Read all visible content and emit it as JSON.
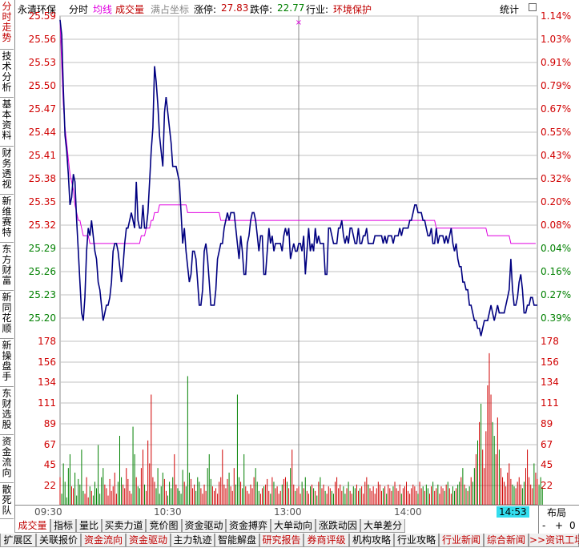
{
  "sidebar": {
    "tabs": [
      {
        "label": "分时走势",
        "active": true
      },
      {
        "label": "技术分析",
        "active": false
      },
      {
        "label": "基本资料",
        "active": false
      },
      {
        "label": "财务透视",
        "active": false
      },
      {
        "label": "新维赛特",
        "active": false
      },
      {
        "label": "东方财富",
        "active": false
      },
      {
        "label": "新同花顺",
        "active": false
      },
      {
        "label": "新操盘手",
        "active": false
      },
      {
        "label": "东财选股",
        "active": false
      },
      {
        "label": "资金流向",
        "active": false
      },
      {
        "label": "散死队",
        "active": false
      }
    ]
  },
  "header": {
    "stock_name": "永清环保",
    "mode": "分时",
    "avg_label": "均线",
    "vol_label": "成交量",
    "scale_label": "满占坐标",
    "limit_up_label": "涨停:",
    "limit_up": "27.83",
    "limit_down_label": "跌停:",
    "limit_down": "22.77",
    "industry_label": "行业:",
    "industry": "环境保护",
    "stats_button": "统计"
  },
  "colors": {
    "price_line": "#000080",
    "avg_line": "#e000e0",
    "up": "#d00000",
    "down": "#008000",
    "grid": "#c0c0c0",
    "accent": "#c00000"
  },
  "chart_data": {
    "type": "line",
    "price_axis": [
      "25.59",
      "25.56",
      "25.53",
      "25.50",
      "25.47",
      "25.44",
      "25.41",
      "25.38",
      "25.35",
      "25.32",
      "25.29",
      "25.26",
      "25.23",
      "25.20"
    ],
    "pct_axis": [
      "1.14%",
      "1.03%",
      "0.91%",
      "0.79%",
      "0.67%",
      "0.55%",
      "0.43%",
      "0.32%",
      "0.20%",
      "0.08%",
      "0.04%",
      "0.16%",
      "0.27%",
      "0.39%"
    ],
    "volume_axis": [
      "178",
      "156",
      "134",
      "111",
      "89",
      "67",
      "45",
      "22"
    ],
    "price_ylim": [
      25.195,
      25.595
    ],
    "time_labels": [
      "09:30",
      "10:30",
      "13:00",
      "14:00"
    ],
    "current_time": "14:53",
    "price": [
      25.59,
      25.57,
      25.5,
      25.44,
      25.42,
      25.39,
      25.35,
      25.36,
      25.39,
      25.38,
      25.33,
      25.29,
      25.25,
      25.21,
      25.2,
      25.23,
      25.29,
      25.32,
      25.31,
      25.33,
      25.31,
      25.29,
      25.28,
      25.25,
      25.24,
      25.22,
      25.2,
      25.21,
      25.22,
      25.22,
      25.23,
      25.25,
      25.29,
      25.3,
      25.3,
      25.29,
      25.27,
      25.25,
      25.27,
      25.3,
      25.32,
      25.32,
      25.33,
      25.34,
      25.33,
      25.32,
      25.38,
      25.33,
      25.32,
      25.32,
      25.35,
      25.32,
      25.32,
      25.34,
      25.38,
      25.42,
      25.45,
      25.53,
      25.51,
      25.48,
      25.44,
      25.42,
      25.4,
      25.47,
      25.49,
      25.47,
      25.45,
      25.43,
      25.4,
      25.4,
      25.4,
      25.39,
      25.38,
      25.34,
      25.3,
      25.32,
      25.29,
      25.27,
      25.25,
      25.26,
      25.29,
      25.29,
      25.28,
      25.25,
      25.22,
      25.22,
      25.24,
      25.29,
      25.3,
      25.28,
      25.25,
      25.22,
      25.22,
      25.22,
      25.24,
      25.28,
      25.29,
      25.3,
      25.3,
      25.32,
      25.33,
      25.34,
      25.33,
      25.34,
      25.34,
      25.34,
      25.32,
      25.3,
      25.28,
      25.31,
      25.29,
      25.26,
      25.26,
      25.3,
      25.31,
      25.33,
      25.34,
      25.34,
      25.33,
      25.31,
      25.29,
      25.31,
      25.31,
      25.26,
      25.26,
      25.29,
      25.32,
      25.3,
      25.31,
      25.29,
      25.3,
      25.3,
      25.3,
      25.3,
      25.29,
      25.31,
      25.32,
      25.31,
      25.32,
      25.28,
      25.29,
      25.3,
      25.29,
      25.29,
      25.3,
      25.3,
      25.29,
      25.31,
      25.26,
      25.29,
      25.32,
      25.29,
      25.3,
      25.29,
      25.32,
      25.3,
      25.31,
      25.3,
      25.3,
      25.3,
      25.26,
      25.26,
      25.32,
      25.32,
      25.31,
      25.3,
      25.3,
      25.3,
      25.32,
      25.32,
      25.33,
      25.31,
      25.3,
      25.31,
      25.3,
      25.32,
      25.32,
      25.31,
      25.3,
      25.3,
      25.32,
      25.3,
      25.3,
      25.31,
      25.31,
      25.32,
      25.3,
      25.3,
      25.3,
      25.3,
      25.31,
      25.31,
      25.31,
      25.31,
      25.31,
      25.3,
      25.31,
      25.3,
      25.31,
      25.31,
      25.31,
      25.3,
      25.31,
      25.31,
      25.31,
      25.32,
      25.31,
      25.32,
      25.32,
      25.32,
      25.32,
      25.33,
      25.33,
      25.34,
      25.35,
      25.35,
      25.34,
      25.34,
      25.34,
      25.33,
      25.33,
      25.32,
      25.31,
      25.31,
      25.32,
      25.3,
      25.3,
      25.32,
      25.3,
      25.31,
      25.31,
      25.31,
      25.3,
      25.31,
      25.3,
      25.31,
      25.32,
      25.3,
      25.29,
      25.3,
      25.28,
      25.27,
      25.27,
      25.25,
      25.25,
      25.24,
      25.24,
      25.22,
      25.22,
      25.21,
      25.2,
      25.2,
      25.19,
      25.19,
      25.18,
      25.19,
      25.2,
      25.2,
      25.2,
      25.21,
      25.22,
      25.21,
      25.2,
      25.21,
      25.22,
      25.21,
      25.21,
      25.21,
      25.21,
      25.22,
      25.23,
      25.24,
      25.28,
      25.24,
      25.22,
      25.22,
      25.23,
      25.25,
      25.26,
      25.24,
      25.21,
      25.21,
      25.22,
      25.22,
      25.23,
      25.23,
      25.22,
      25.22,
      25.22
    ],
    "avg": [
      25.59,
      25.53,
      25.48,
      25.45,
      25.43,
      25.41,
      25.39,
      25.38,
      25.37,
      25.35,
      25.34,
      25.33,
      25.33,
      25.32,
      25.31,
      25.31,
      25.31,
      25.31,
      25.3,
      25.3,
      25.3,
      25.3,
      25.3,
      25.3,
      25.3,
      25.3,
      25.3,
      25.3,
      25.3,
      25.3,
      25.3,
      25.3,
      25.3,
      25.3,
      25.3,
      25.3,
      25.3,
      25.3,
      25.3,
      25.3,
      25.3,
      25.3,
      25.3,
      25.3,
      25.3,
      25.3,
      25.3,
      25.3,
      25.3,
      25.31,
      25.31,
      25.31,
      25.32,
      25.32,
      25.32,
      25.33,
      25.33,
      25.34,
      25.34,
      25.34,
      25.35,
      25.35,
      25.35,
      25.35,
      25.35,
      25.35,
      25.35,
      25.35,
      25.35,
      25.35,
      25.35,
      25.35,
      25.35,
      25.35,
      25.35,
      25.35,
      25.35,
      25.34,
      25.34,
      25.34,
      25.34,
      25.34,
      25.34,
      25.34,
      25.34,
      25.34,
      25.34,
      25.34,
      25.34,
      25.34,
      25.34,
      25.34,
      25.34,
      25.34,
      25.34,
      25.34,
      25.34,
      25.33,
      25.33,
      25.33,
      25.33,
      25.33,
      25.33,
      25.33,
      25.33,
      25.33,
      25.33,
      25.33,
      25.33,
      25.33,
      25.33,
      25.33,
      25.33,
      25.33,
      25.33,
      25.33,
      25.33,
      25.33,
      25.33,
      25.33,
      25.33,
      25.33,
      25.33,
      25.33,
      25.33,
      25.33,
      25.33,
      25.33,
      25.33,
      25.33,
      25.33,
      25.33,
      25.33,
      25.33,
      25.33,
      25.33,
      25.33,
      25.33,
      25.33,
      25.33,
      25.33,
      25.33,
      25.33,
      25.33,
      25.33,
      25.33,
      25.33,
      25.33,
      25.33,
      25.33,
      25.33,
      25.33,
      25.33,
      25.33,
      25.33,
      25.33,
      25.33,
      25.33,
      25.33,
      25.33,
      25.33,
      25.33,
      25.33,
      25.33,
      25.33,
      25.33,
      25.33,
      25.33,
      25.33,
      25.33,
      25.33,
      25.33,
      25.33,
      25.33,
      25.33,
      25.33,
      25.33,
      25.33,
      25.33,
      25.33,
      25.33,
      25.33,
      25.33,
      25.33,
      25.33,
      25.33,
      25.33,
      25.33,
      25.33,
      25.33,
      25.33,
      25.33,
      25.33,
      25.33,
      25.33,
      25.33,
      25.33,
      25.33,
      25.33,
      25.33,
      25.33,
      25.33,
      25.33,
      25.33,
      25.33,
      25.33,
      25.33,
      25.33,
      25.33,
      25.33,
      25.33,
      25.33,
      25.33,
      25.33,
      25.33,
      25.33,
      25.33,
      25.33,
      25.33,
      25.33,
      25.33,
      25.33,
      25.33,
      25.33,
      25.33,
      25.33,
      25.33,
      25.32,
      25.32,
      25.32,
      25.32,
      25.32,
      25.32,
      25.32,
      25.32,
      25.32,
      25.32,
      25.32,
      25.32,
      25.32,
      25.32,
      25.32,
      25.32,
      25.32,
      25.32,
      25.32,
      25.32,
      25.32,
      25.32,
      25.32,
      25.32,
      25.32,
      25.32,
      25.32,
      25.32,
      25.32,
      25.32,
      25.32,
      25.31,
      25.31,
      25.31,
      25.31,
      25.31,
      25.31,
      25.31,
      25.31,
      25.31,
      25.31,
      25.31,
      25.31,
      25.31,
      25.31,
      25.3,
      25.3,
      25.3,
      25.3,
      25.3,
      25.3,
      25.3,
      25.3,
      25.3,
      25.3,
      25.3,
      25.3,
      25.3,
      25.3,
      25.3,
      25.3
    ],
    "volume_ylim": [
      0,
      178
    ],
    "volume": [
      30,
      12,
      45,
      25,
      8,
      40,
      55,
      20,
      18,
      35,
      10,
      28,
      22,
      60,
      15,
      12,
      30,
      8,
      20,
      15,
      10,
      25,
      18,
      65,
      12,
      30,
      40,
      22,
      18,
      10,
      28,
      15,
      20,
      35,
      12,
      25,
      75,
      30,
      22,
      18,
      40,
      28,
      15,
      12,
      85,
      55,
      30,
      20,
      18,
      40,
      60,
      22,
      15,
      70,
      45,
      120,
      30,
      25,
      18,
      40,
      12,
      20,
      35,
      28,
      15,
      10,
      25,
      18,
      30,
      55,
      22,
      18,
      15,
      12,
      38,
      25,
      20,
      140,
      35,
      28,
      18,
      22,
      15,
      30,
      25,
      18,
      12,
      22,
      15,
      40,
      55,
      28,
      20,
      15,
      18,
      12,
      25,
      30,
      60,
      22,
      18,
      28,
      35,
      20,
      15,
      40,
      22,
      120,
      30,
      25,
      18,
      55,
      20,
      15,
      12,
      22,
      18,
      30,
      40,
      25,
      15,
      12,
      18,
      20,
      22,
      28,
      15,
      12,
      30,
      25,
      18,
      20,
      12,
      15,
      22,
      28,
      30,
      25,
      18,
      40,
      60,
      22,
      15,
      18,
      20,
      12,
      25,
      18,
      30,
      15,
      12,
      20,
      22,
      18,
      15,
      10,
      25,
      30,
      18,
      22,
      15,
      12,
      20,
      18,
      15,
      12,
      25,
      30,
      18,
      22,
      15,
      20,
      12,
      18,
      25,
      15,
      12,
      20,
      18,
      22,
      15,
      18,
      20,
      12,
      25,
      30,
      22,
      18,
      15,
      20,
      12,
      18,
      25,
      22,
      15,
      18,
      20,
      12,
      22,
      18,
      15,
      20,
      25,
      18,
      15,
      22,
      12,
      18,
      20,
      25,
      15,
      12,
      18,
      22,
      20,
      15,
      12,
      25,
      18,
      20,
      15,
      22,
      18,
      12,
      20,
      25,
      15,
      18,
      22,
      12,
      20,
      18,
      15,
      22,
      25,
      18,
      12,
      20,
      15,
      18,
      22,
      25,
      30,
      40,
      22,
      18,
      15,
      20,
      30,
      25,
      40,
      55,
      70,
      90,
      110,
      60,
      40,
      80,
      130,
      165,
      120,
      90,
      75,
      55,
      95,
      60,
      40,
      30,
      25,
      20,
      35,
      45,
      28,
      22,
      20,
      18,
      25,
      30,
      22,
      18,
      25,
      40,
      60,
      30,
      22,
      18,
      45,
      35,
      28,
      22,
      30,
      18
    ]
  },
  "footer": {
    "layout_label": "布局",
    "minus": "-",
    "plus": "+",
    "zero": "0"
  },
  "tabs_row1": [
    {
      "label": "成交量",
      "style": "active"
    },
    {
      "label": "指标",
      "style": ""
    },
    {
      "label": "量比",
      "style": ""
    },
    {
      "label": "买卖力道",
      "style": ""
    },
    {
      "label": "竞价图",
      "style": ""
    },
    {
      "label": "资金驱动",
      "style": ""
    },
    {
      "label": "资金搏弈",
      "style": ""
    },
    {
      "label": "大单动向",
      "style": ""
    },
    {
      "label": "涨跌动因",
      "style": ""
    },
    {
      "label": "大单差分",
      "style": ""
    }
  ],
  "tabs_row2": [
    {
      "label": "扩展区",
      "style": ""
    },
    {
      "label": "关联报价",
      "style": ""
    },
    {
      "label": "资金流向",
      "style": "red"
    },
    {
      "label": "资金驱动",
      "style": "red"
    },
    {
      "label": "主力轨迹",
      "style": ""
    },
    {
      "label": "智能解盘",
      "style": ""
    },
    {
      "label": "研究报告",
      "style": "red"
    },
    {
      "label": "券商评级",
      "style": "red"
    },
    {
      "label": "机构攻略",
      "style": ""
    },
    {
      "label": "行业攻略",
      "style": ""
    },
    {
      "label": "行业新闻",
      "style": "red"
    },
    {
      "label": "综合新闻",
      "style": "red"
    },
    {
      "label": ">>资讯工场",
      "style": "red"
    }
  ]
}
